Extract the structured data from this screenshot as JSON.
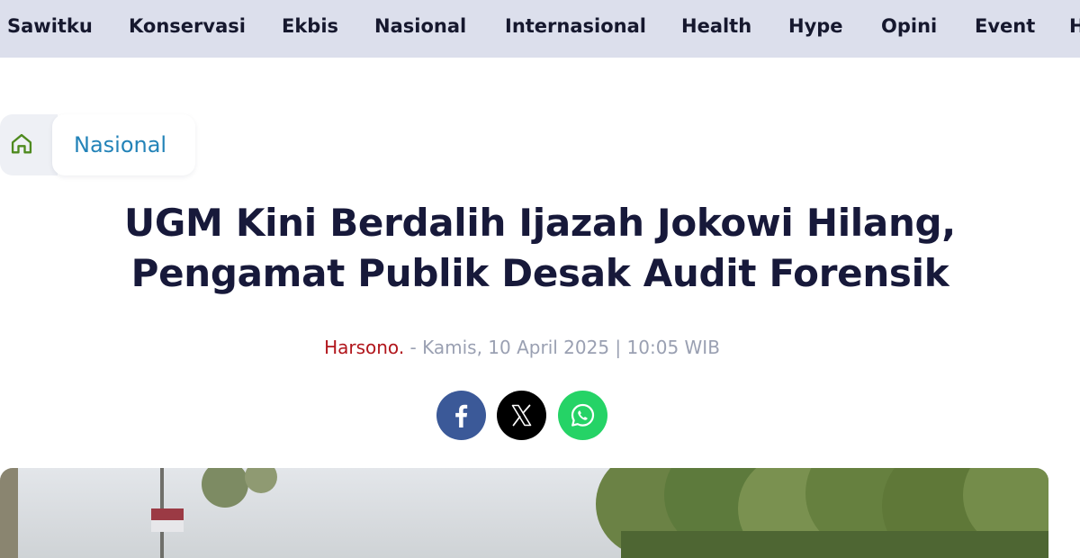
{
  "nav": {
    "items": [
      {
        "label": "Sawitku"
      },
      {
        "label": "Konservasi"
      },
      {
        "label": "Ekbis"
      },
      {
        "label": "Nasional"
      },
      {
        "label": "Internasional"
      },
      {
        "label": "Health"
      },
      {
        "label": "Hype"
      },
      {
        "label": "Opini"
      },
      {
        "label": "Event"
      },
      {
        "label": "H"
      }
    ]
  },
  "breadcrumb": {
    "home_icon": "home-icon",
    "category": "Nasional"
  },
  "article": {
    "title_line1": "UGM Kini Berdalih Ijazah Jokowi Hilang,",
    "title_line2": "Pengamat Publik Desak Audit Forensik",
    "author": "Harsono.",
    "date": "- Kamis, 10 April 2025 | 10:05 WIB"
  },
  "share": {
    "facebook_icon": "facebook-icon",
    "x_icon": "x-icon",
    "whatsapp_icon": "whatsapp-icon"
  },
  "colors": {
    "nav_bg": "#dcdfec",
    "category_text": "#2383b8",
    "author_text": "#b1151b",
    "facebook": "#3b5998",
    "x": "#000000",
    "whatsapp": "#25d366"
  }
}
